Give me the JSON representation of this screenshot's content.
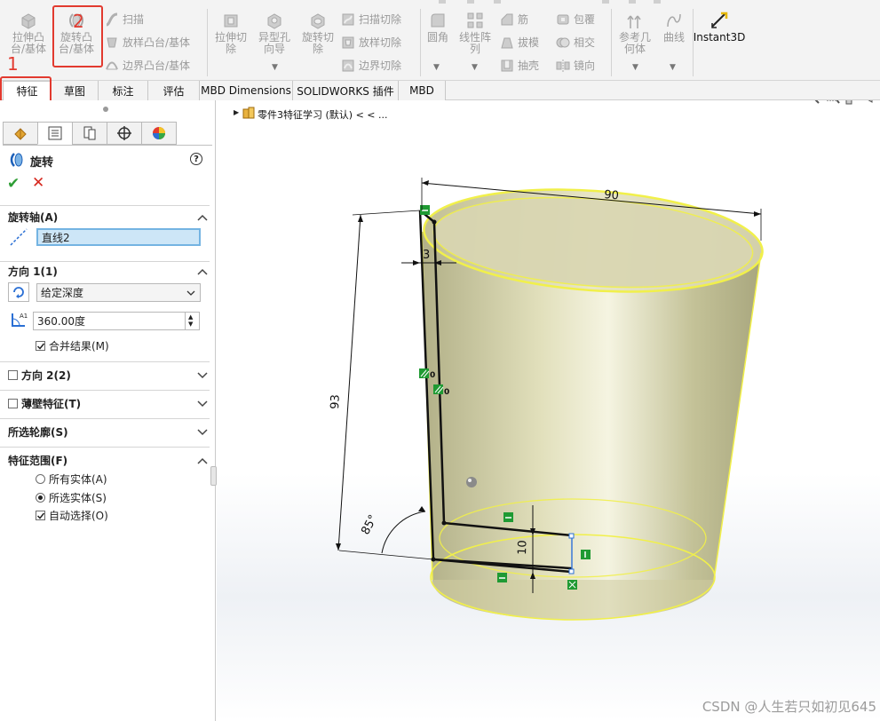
{
  "ribbon": {
    "extrude_boss": "拉伸凸\n台/基体",
    "revolve_boss": "旋转凸\n台/基体",
    "sweep": "扫描",
    "loft_boss": "放样凸台/基体",
    "boundary_boss": "边界凸台/基体",
    "extrude_cut": "拉伸切\n除",
    "hole_wizard": "异型孔\n向导",
    "revolve_cut": "旋转切\n除",
    "swept_cut": "扫描切除",
    "lofted_cut": "放样切除",
    "boundary_cut": "边界切除",
    "fillet": "圆角",
    "linear_pattern": "线性阵\n列",
    "rib": "筋",
    "draft": "拔模",
    "shell": "抽壳",
    "wrap": "包覆",
    "intersect": "相交",
    "mirror": "镜向",
    "ref_geometry": "参考几\n何体",
    "curves": "曲线",
    "instant3d": "Instant3D"
  },
  "tabs": [
    "特征",
    "草图",
    "标注",
    "评估",
    "MBD Dimensions",
    "SOLIDWORKS 插件",
    "MBD"
  ],
  "annotations": {
    "one": "1",
    "two": "2"
  },
  "tree_path": "零件3特征学习 (默认) < < ...",
  "panel": {
    "title": "旋转",
    "help": "?",
    "axis_section": "旋转轴(A)",
    "axis_value": "直线2",
    "dir1_section": "方向 1(1)",
    "end_condition": "给定深度",
    "angle": "360.00度",
    "merge_result": "合并结果(M)",
    "dir2_section": "方向 2(2)",
    "thin_section": "薄壁特征(T)",
    "contours_section": "所选轮廓(S)",
    "scope_section": "特征范围(F)",
    "all_bodies": "所有实体(A)",
    "selected_bodies": "所选实体(S)",
    "auto_select": "自动选择(O)",
    "merge_checked": true,
    "auto_checked": true,
    "scope_choice": "所选实体(S)"
  },
  "dims": {
    "d90": "90",
    "d3": "3",
    "d93": "93",
    "d85": "85°",
    "d10": "10"
  },
  "watermark": "CSDN @人生若只如初见645",
  "colors": {
    "accent": "#0d6ad8",
    "annotation": "#e23a2f",
    "body": "#d2cfa0",
    "edge": "#f1f04a"
  }
}
